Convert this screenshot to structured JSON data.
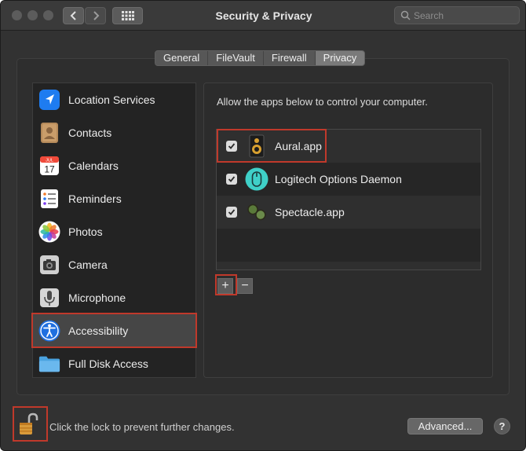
{
  "window": {
    "title": "Security & Privacy"
  },
  "search": {
    "placeholder": "Search"
  },
  "tabs": [
    {
      "label": "General"
    },
    {
      "label": "FileVault"
    },
    {
      "label": "Firewall"
    },
    {
      "label": "Privacy",
      "active": true
    }
  ],
  "sidebar": {
    "items": [
      {
        "label": "Location Services",
        "icon": "location-arrow-icon"
      },
      {
        "label": "Contacts",
        "icon": "contacts-book-icon"
      },
      {
        "label": "Calendars",
        "icon": "calendar-icon",
        "icon_text_month": "JUL",
        "icon_text_day": "17"
      },
      {
        "label": "Reminders",
        "icon": "reminders-list-icon"
      },
      {
        "label": "Photos",
        "icon": "photos-flower-icon"
      },
      {
        "label": "Camera",
        "icon": "camera-icon"
      },
      {
        "label": "Microphone",
        "icon": "microphone-icon"
      },
      {
        "label": "Accessibility",
        "icon": "accessibility-person-icon",
        "selected": true
      },
      {
        "label": "Full Disk Access",
        "icon": "folder-icon"
      }
    ]
  },
  "panel": {
    "allow_text": "Allow the apps below to control your computer.",
    "apps": [
      {
        "name": "Aural.app",
        "checked": true,
        "icon": "speaker-icon"
      },
      {
        "name": "Logitech Options Daemon",
        "checked": true,
        "icon": "mouse-icon"
      },
      {
        "name": "Spectacle.app",
        "checked": true,
        "icon": "spectacles-icon"
      }
    ],
    "add_label": "+",
    "remove_label": "−"
  },
  "footer": {
    "lock_text": "Click the lock to prevent further changes.",
    "advanced_label": "Advanced...",
    "help_label": "?"
  },
  "colors": {
    "highlight": "#c0392b",
    "window_bg": "#323232",
    "selected_row": "#464646"
  }
}
